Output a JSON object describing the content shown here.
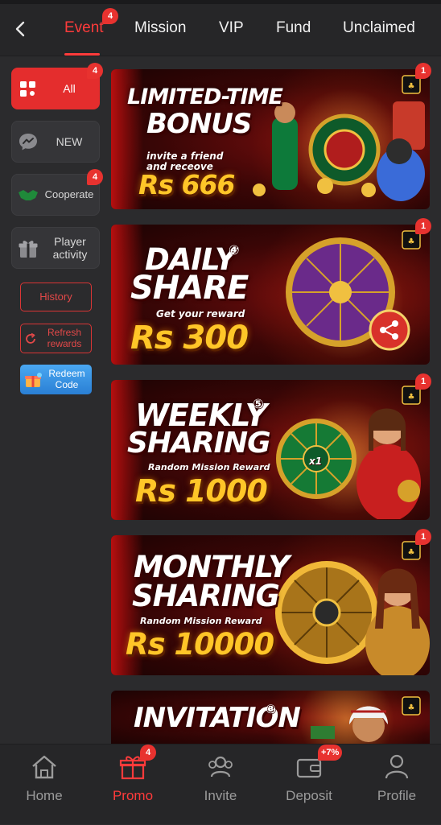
{
  "header": {
    "tabs": [
      {
        "label": "Event",
        "badge": "4",
        "active": true
      },
      {
        "label": "Mission"
      },
      {
        "label": "VIP"
      },
      {
        "label": "Fund"
      },
      {
        "label": "Unclaimed"
      }
    ]
  },
  "sidebar": {
    "categories": [
      {
        "label": "All",
        "badge": "4",
        "active": true
      },
      {
        "label": "NEW"
      },
      {
        "label": "Cooperate",
        "badge": "4"
      },
      {
        "label": "Player activity"
      }
    ],
    "history_label": "History",
    "refresh_label": "Refresh rewards",
    "redeem_label": "Redeem Code"
  },
  "banners": [
    {
      "line1": "LIMITED-TIME",
      "line2": "BONUS",
      "sub": "invite a friend and receove",
      "amount": "Rs 666",
      "badge": "1"
    },
    {
      "line1": "DAILY",
      "line2": "SHARE",
      "mark": "④",
      "sub": "Get your reward",
      "amount": "Rs 300",
      "badge": "1"
    },
    {
      "line1": "WEEKLY",
      "line2": "SHARING",
      "mark": "⑤",
      "sub": "Random Mission Reward",
      "amount": "Rs 1000",
      "badge": "1",
      "wheel_text": "x1"
    },
    {
      "line1": "MONTHLY",
      "line2": "SHARING",
      "sub": "Random Mission Reward",
      "amount": "Rs 10000",
      "badge": "1"
    },
    {
      "line1": "INVITATION",
      "mark": "③"
    }
  ],
  "bottom_nav": {
    "items": [
      {
        "label": "Home",
        "icon": "home-icon"
      },
      {
        "label": "Promo",
        "icon": "gift-icon",
        "badge": "4",
        "active": true
      },
      {
        "label": "Invite",
        "icon": "people-icon"
      },
      {
        "label": "Deposit",
        "icon": "wallet-icon",
        "badge": "+7%"
      },
      {
        "label": "Profile",
        "icon": "person-icon"
      }
    ]
  },
  "colors": {
    "accent": "#e42d2d",
    "background": "#2b2b2d",
    "bar": "#262628",
    "gold": "#ffc628"
  }
}
